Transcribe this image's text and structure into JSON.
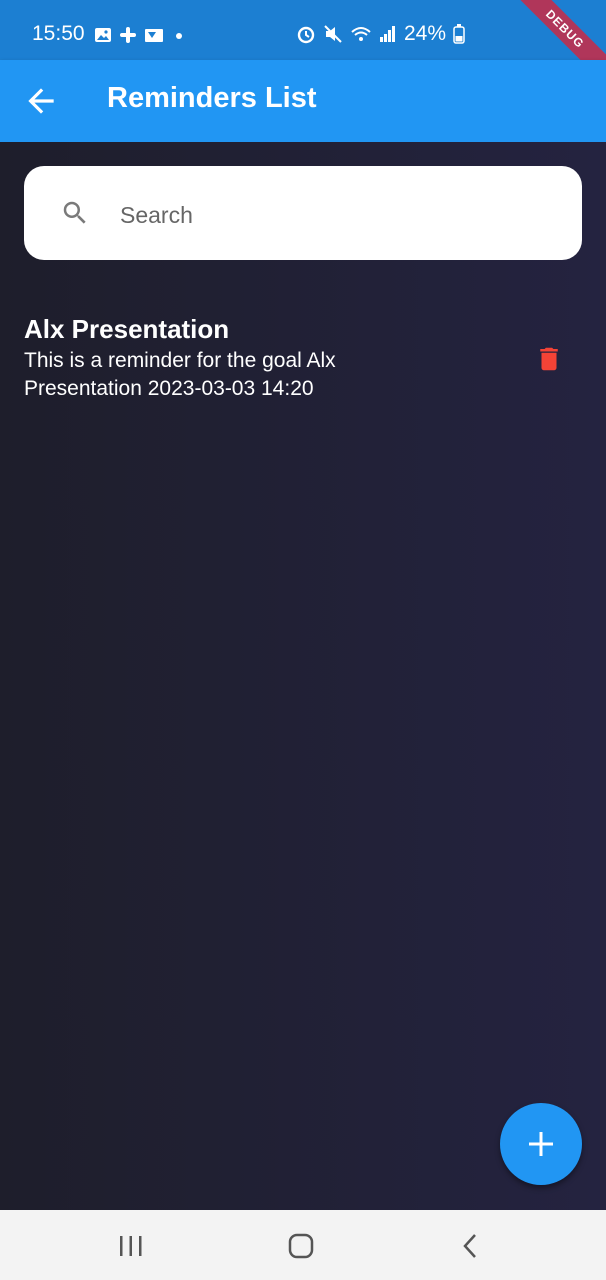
{
  "status_bar": {
    "time": "15:50",
    "battery": "24%",
    "left_icons": [
      "image-icon",
      "slack-icon",
      "gallery-icon",
      "dot-icon"
    ],
    "right_icons": [
      "alarm-icon",
      "mute-icon",
      "wifi-icon",
      "signal-icon",
      "battery-icon"
    ]
  },
  "debug_banner": "DEBUG",
  "app_bar": {
    "title": "Reminders List",
    "back_icon": "arrow-back-icon"
  },
  "search": {
    "placeholder": "Search",
    "value": "",
    "icon": "search-icon"
  },
  "reminders": [
    {
      "title": "Alx Presentation",
      "description": "This is a reminder for the goal Alx Presentation  2023-03-03 14:20",
      "delete_icon": "trash-icon"
    }
  ],
  "fab": {
    "icon": "plus-icon"
  },
  "nav_bar": {
    "items": [
      "recent-apps",
      "home",
      "back"
    ]
  },
  "colors": {
    "status_bar": "#1c7fd2",
    "app_bar": "#2196f3",
    "background": "#1e1e2c",
    "delete": "#f44336",
    "fab": "#2196f3"
  }
}
